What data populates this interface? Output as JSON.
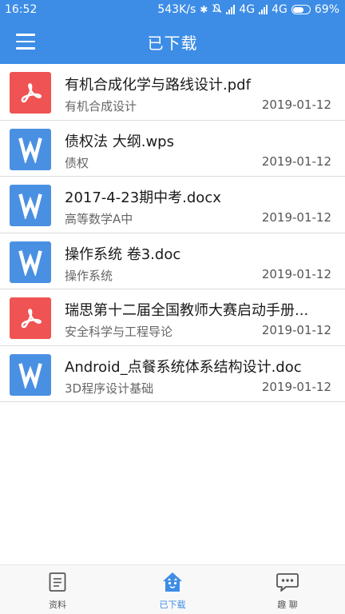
{
  "status_bar": {
    "time": "16:52",
    "network_speed": "543K/s",
    "network_1": "4G",
    "network_2": "4G",
    "battery": "69%",
    "battery_level": 0.69
  },
  "app_bar": {
    "title": "已下载"
  },
  "files": [
    {
      "type": "pdf",
      "name": "有机合成化学与路线设计.pdf",
      "course": "有机合成设计",
      "date": "2019-01-12"
    },
    {
      "type": "doc",
      "name": "债权法 大纲.wps",
      "course": "债权",
      "date": "2019-01-12"
    },
    {
      "type": "doc",
      "name": "2017-4-23期中考.docx",
      "course": "高等数学A中",
      "date": "2019-01-12"
    },
    {
      "type": "doc",
      "name": "操作系统 卷3.doc",
      "course": "操作系统",
      "date": "2019-01-12"
    },
    {
      "type": "pdf",
      "name": "瑞思第十二届全国教师大赛启动手册...",
      "course": "安全科学与工程导论",
      "date": "2019-01-12"
    },
    {
      "type": "doc",
      "name": "Android_点餐系统体系结构设计.doc",
      "course": "3D程序设计基础",
      "date": "2019-01-12"
    }
  ],
  "bottom_nav": [
    {
      "label": "资料",
      "icon": "document-icon",
      "active": false
    },
    {
      "label": "已下载",
      "icon": "downloaded-icon",
      "active": true
    },
    {
      "label": "趣 聊",
      "icon": "chat-icon",
      "active": false
    }
  ],
  "colors": {
    "primary": "#3d8de6",
    "pdf": "#ef5353",
    "doc": "#4a90e2"
  }
}
